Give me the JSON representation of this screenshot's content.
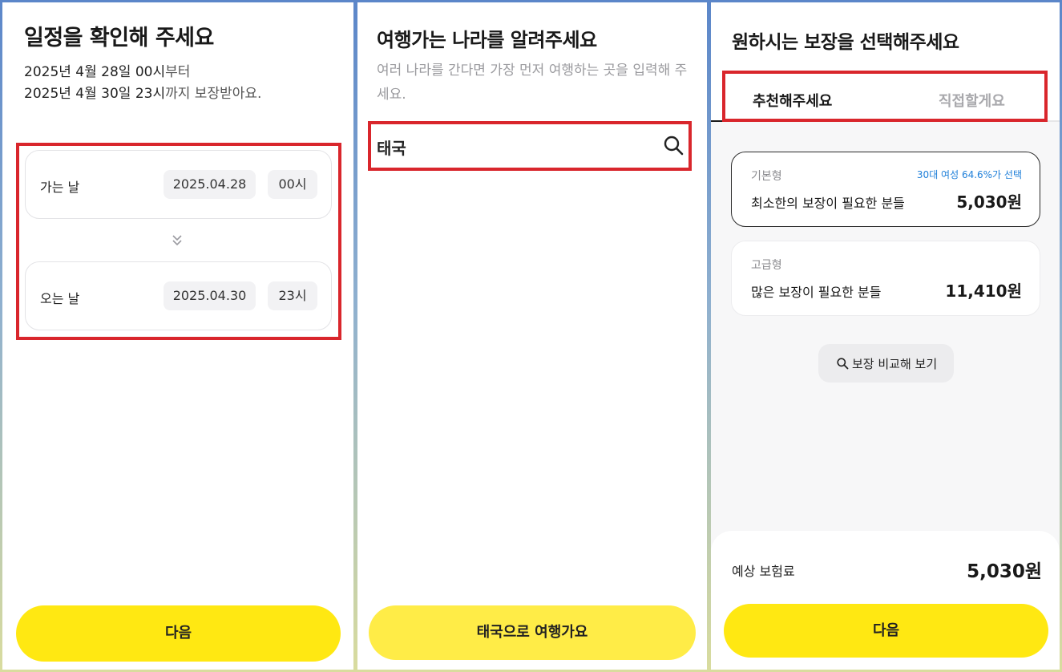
{
  "panel1": {
    "title": "일정을 확인해 주세요",
    "line1": {
      "start": "2025년 4월 28일 00시",
      "suffix": "부터"
    },
    "line2": {
      "start": "2025년 4월 30일 23시",
      "suffix": "까지 보장받아요."
    },
    "depart": {
      "label": "가는 날",
      "date": "2025.04.28",
      "hour": "00시"
    },
    "return": {
      "label": "오는 날",
      "date": "2025.04.30",
      "hour": "23시"
    },
    "next_button": "다음"
  },
  "panel2": {
    "title": "여행가는 나라를 알려주세요",
    "hint": "여러 나라를 간다면 가장 먼저 여행하는 곳을 입력해 주세요.",
    "search_value": "태국",
    "submit_button": "태국으로 여행가요"
  },
  "panel3": {
    "title": "원하시는 보장을 선택해주세요",
    "tabs": [
      "추천해주세요",
      "직접할게요"
    ],
    "plans": [
      {
        "type": "기본형",
        "desc": "최소한의 보장이 필요한 분들",
        "price": "5,030원",
        "stat": "30대 여성 64.6%가 선택"
      },
      {
        "type": "고급형",
        "desc": "많은 보장이 필요한 분들",
        "price": "11,410원"
      }
    ],
    "compare_button": "보장 비교해 보기",
    "premium_label": "예상 보험료",
    "premium_value": "5,030원",
    "next_button": "다음"
  },
  "colors": {
    "accent": "#ffe812",
    "highlight": "#d9262c",
    "link": "#1e7fd9"
  }
}
